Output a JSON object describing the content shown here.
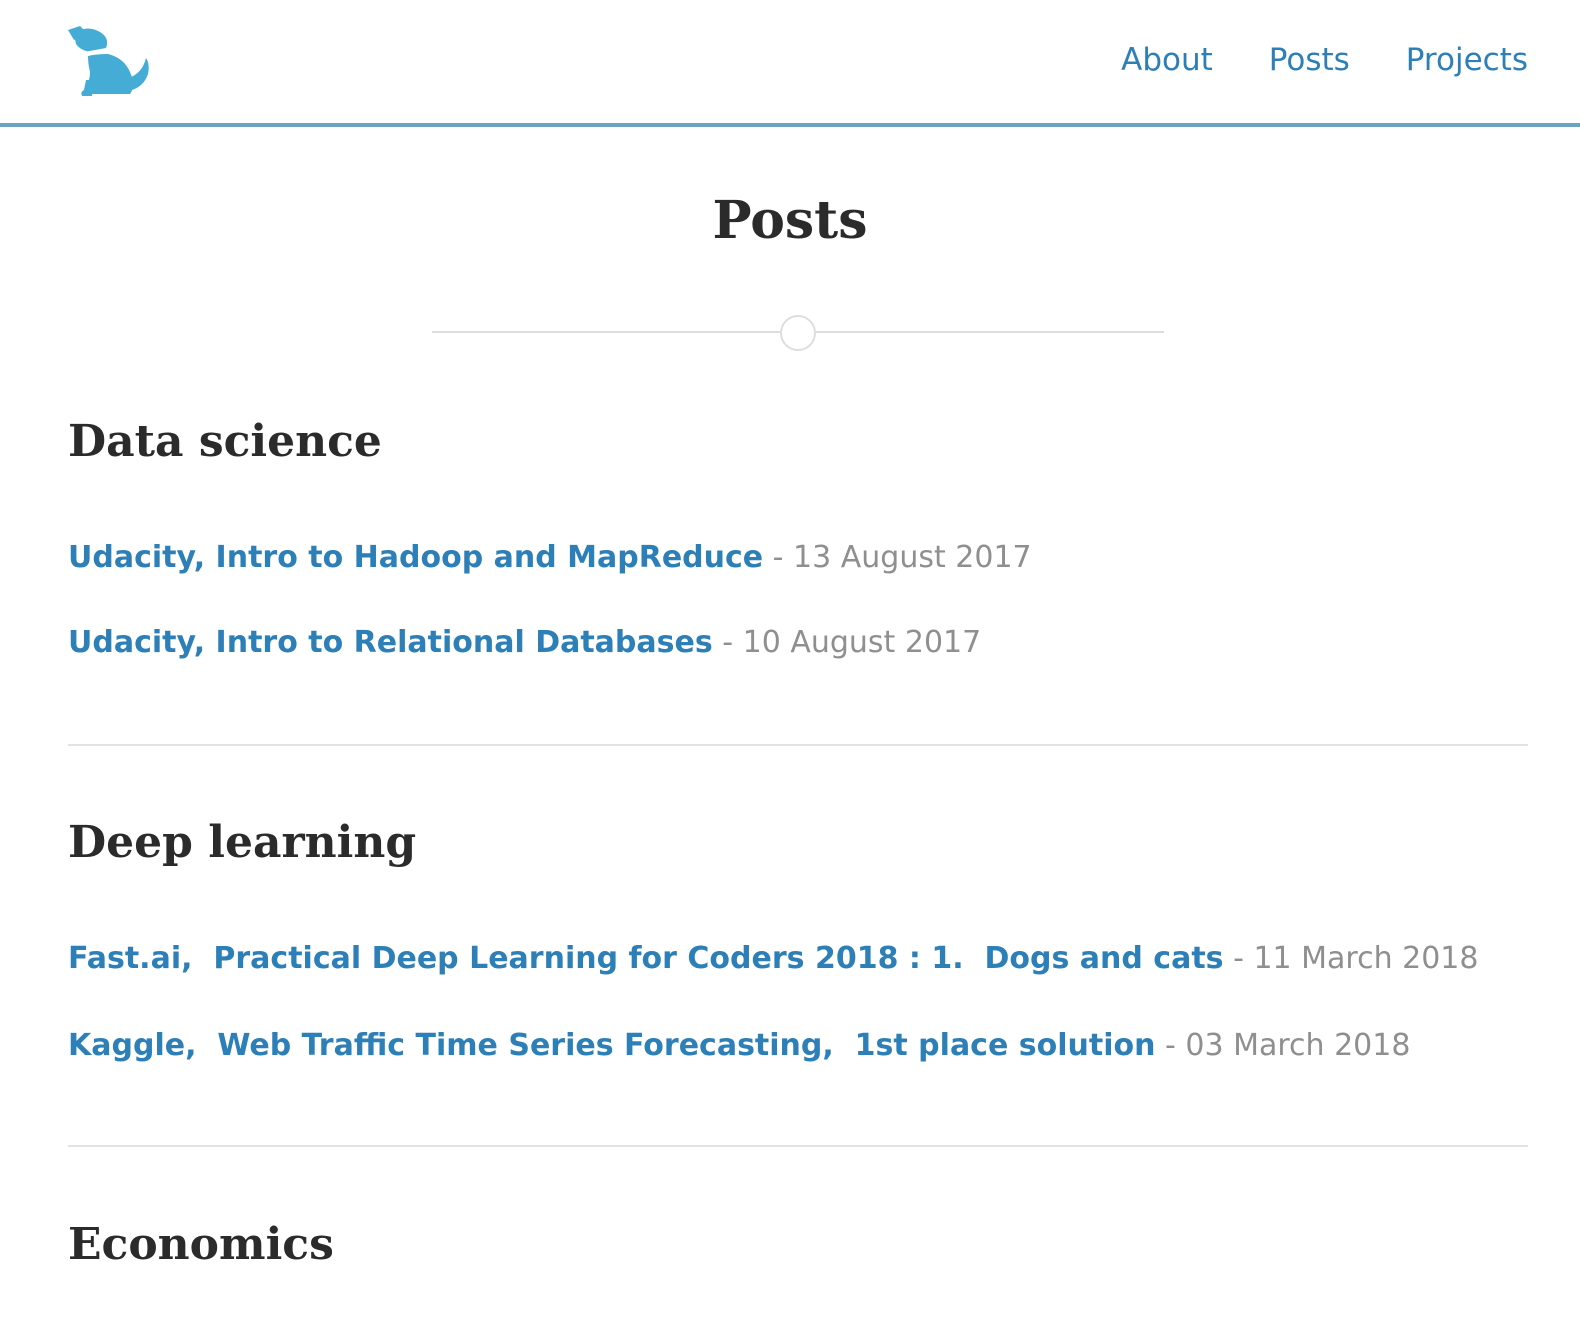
{
  "header": {
    "logo_icon": "dog-icon",
    "nav": [
      {
        "label": "About"
      },
      {
        "label": "Posts"
      },
      {
        "label": "Projects"
      }
    ]
  },
  "page": {
    "title": "Posts"
  },
  "sections": [
    {
      "heading": "Data science",
      "posts": [
        {
          "title": "Udacity, Intro to Hadoop and MapReduce",
          "date": "13 August 2017"
        },
        {
          "title": "Udacity, Intro to Relational Databases",
          "date": "10 August 2017"
        }
      ]
    },
    {
      "heading": "Deep learning",
      "posts": [
        {
          "title": "Fast.ai,  Practical Deep Learning for Coders 2018 : 1.  Dogs and cats",
          "date": "11 March 2018"
        },
        {
          "title": "Kaggle,  Web Traffic Time Series Forecasting,  1st place solution",
          "date": "03 March 2018"
        }
      ]
    },
    {
      "heading": "Economics",
      "posts": []
    }
  ],
  "date_separator": " - ",
  "colors": {
    "link": "#2d7fb8",
    "header_border": "#6ba4c0",
    "logo": "#45acd6",
    "heading": "#2b2b2b",
    "date": "#8f8f8f",
    "divider": "#e2e2e2"
  }
}
